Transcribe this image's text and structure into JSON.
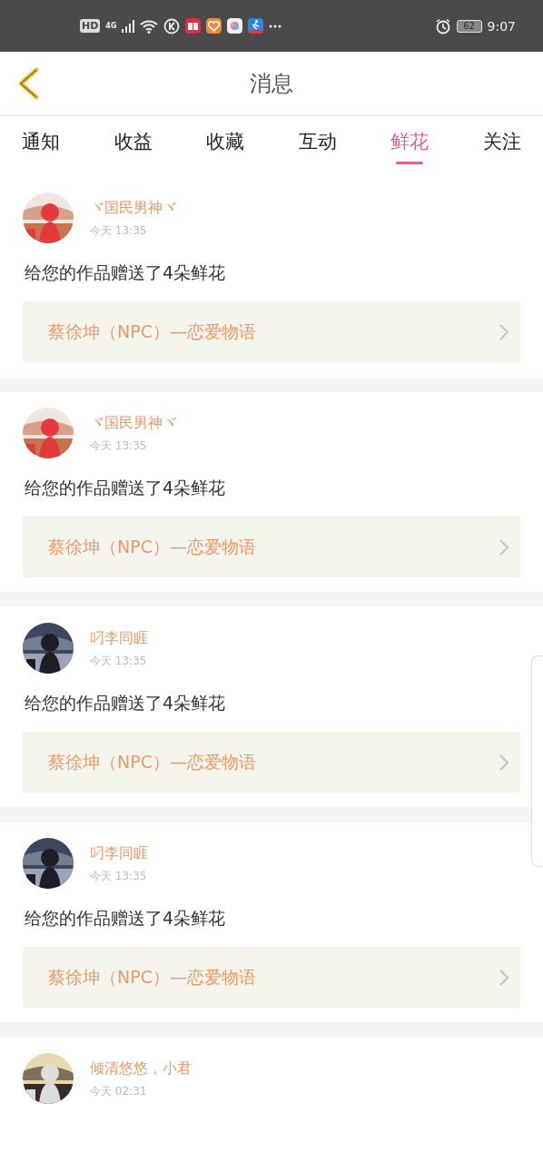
{
  "status_bar": {
    "hd": "HD",
    "network": "4G",
    "battery": "62",
    "time": "9:07"
  },
  "header": {
    "title": "消息"
  },
  "tabs": [
    {
      "label": "通知",
      "selected": false
    },
    {
      "label": "收益",
      "selected": false
    },
    {
      "label": "收藏",
      "selected": false
    },
    {
      "label": "互动",
      "selected": false
    },
    {
      "label": "鲜花",
      "selected": true
    },
    {
      "label": "关注",
      "selected": false
    }
  ],
  "messages": [
    {
      "name": "ヾ国民男神ヾ",
      "time": "今天 13:35",
      "text": "给您的作品赠送了4朵鲜花",
      "work": "蔡徐坤（NPC）—恋爱物语"
    },
    {
      "name": "ヾ国民男神ヾ",
      "time": "今天 13:35",
      "text": "给您的作品赠送了4朵鲜花",
      "work": "蔡徐坤（NPC）—恋爱物语"
    },
    {
      "name": "叼李同睚",
      "time": "今天 13:35",
      "text": "给您的作品赠送了4朵鲜花",
      "work": "蔡徐坤（NPC）—恋爱物语"
    },
    {
      "name": "叼李同睚",
      "time": "今天 13:35",
      "text": "给您的作品赠送了4朵鲜花",
      "work": "蔡徐坤（NPC）—恋爱物语"
    },
    {
      "name": "倾清悠悠，小君",
      "time": "今天 02:31"
    }
  ]
}
